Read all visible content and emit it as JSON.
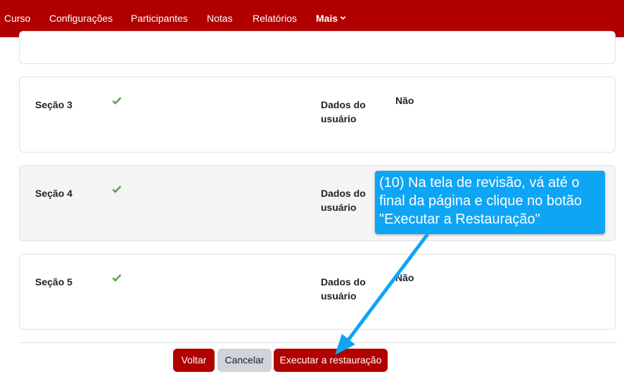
{
  "navbar": {
    "items": [
      {
        "label": "Curso"
      },
      {
        "label": "Configurações"
      },
      {
        "label": "Participantes"
      },
      {
        "label": "Notas"
      },
      {
        "label": "Relatórios"
      },
      {
        "label": "Mais"
      }
    ],
    "active": "Mais",
    "background": "#b00000"
  },
  "sections": [
    {
      "name": "Seção 3",
      "included": true,
      "field_label": "Dados do usuário",
      "field_value": "Não"
    },
    {
      "name": "Seção 4",
      "included": true,
      "field_label": "Dados do usuário",
      "field_value": ""
    },
    {
      "name": "Seção 5",
      "included": true,
      "field_label": "Dados do usuário",
      "field_value": "Não"
    }
  ],
  "buttons": {
    "back": "Voltar",
    "cancel": "Cancelar",
    "execute": "Executar a restauração"
  },
  "callout": {
    "text": "(10) Na tela de revisão, vá até o final da página e clique no botão \"Executar a Restauração\"",
    "color": "#0ea5f5"
  },
  "icons": {
    "check": "check-icon",
    "chevron": "chevron-down-icon",
    "arrow": "arrow-icon"
  }
}
